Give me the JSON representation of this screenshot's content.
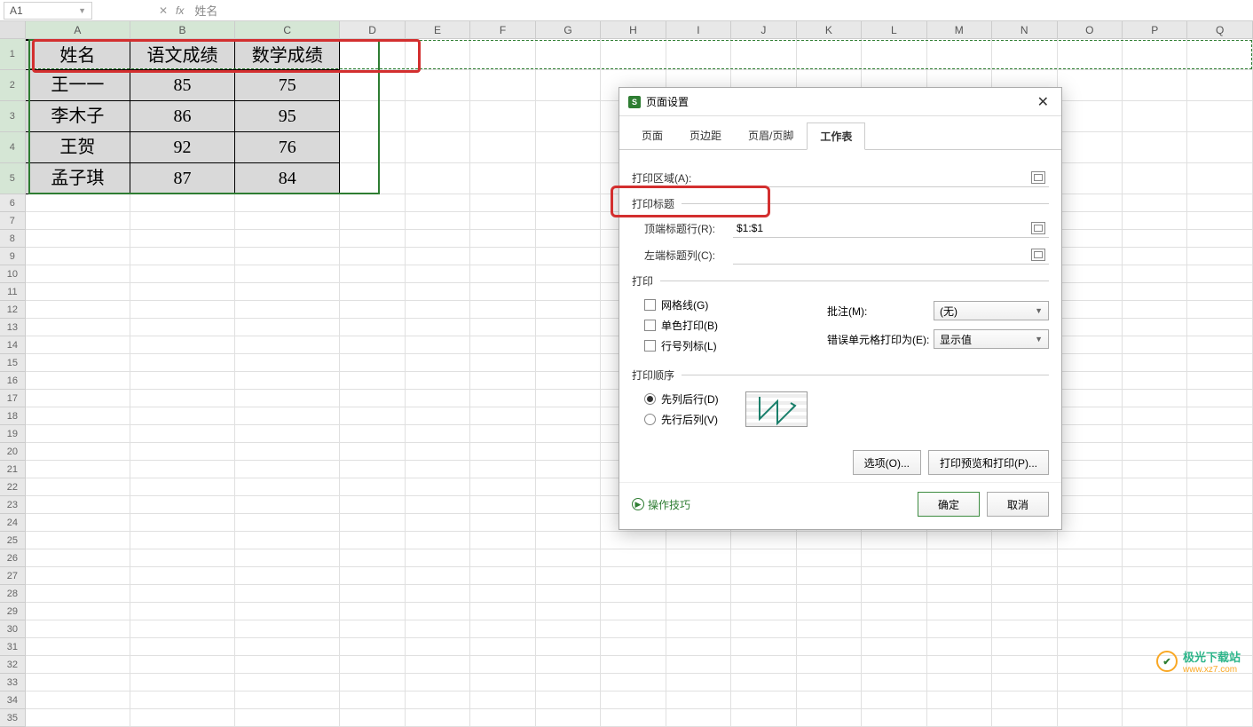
{
  "formula_bar": {
    "name_box_value": "A1",
    "fx_label": "fx",
    "content": "姓名"
  },
  "columns": [
    "A",
    "B",
    "C",
    "D",
    "E",
    "F",
    "G",
    "H",
    "I",
    "J",
    "K",
    "L",
    "M",
    "N",
    "O",
    "P",
    "Q"
  ],
  "column_widths": {
    "data": 132,
    "default": 82
  },
  "selected_columns": [
    "A",
    "B",
    "C"
  ],
  "data_rows": [
    1,
    2,
    3,
    4,
    5
  ],
  "table": {
    "headers": [
      "姓名",
      "语文成绩",
      "数学成绩"
    ],
    "rows": [
      [
        "王一一",
        "85",
        "75"
      ],
      [
        "李木子",
        "86",
        "95"
      ],
      [
        "王贺",
        "92",
        "76"
      ],
      [
        "孟子琪",
        "87",
        "84"
      ]
    ]
  },
  "dialog": {
    "title": "页面设置",
    "tabs": [
      "页面",
      "页边距",
      "页眉/页脚",
      "工作表"
    ],
    "active_tab": 3,
    "print_area_label": "打印区域(A):",
    "print_area_value": "",
    "print_titles_label": "打印标题",
    "top_row_label": "顶端标题行(R):",
    "top_row_value": "$1:$1",
    "left_col_label": "左端标题列(C):",
    "left_col_value": "",
    "print_section": "打印",
    "gridlines": "网格线(G)",
    "monochrome": "单色打印(B)",
    "row_col_headings": "行号列标(L)",
    "comments_label": "批注(M):",
    "comments_value": "(无)",
    "errors_label": "错误单元格打印为(E):",
    "errors_value": "显示值",
    "order_section": "打印顺序",
    "order_down": "先列后行(D)",
    "order_over": "先行后列(V)",
    "options_btn": "选项(O)...",
    "preview_btn": "打印预览和打印(P)...",
    "tips": "操作技巧",
    "ok": "确定",
    "cancel": "取消"
  },
  "watermark": {
    "title": "极光下载站",
    "url": "www.xz7.com"
  }
}
